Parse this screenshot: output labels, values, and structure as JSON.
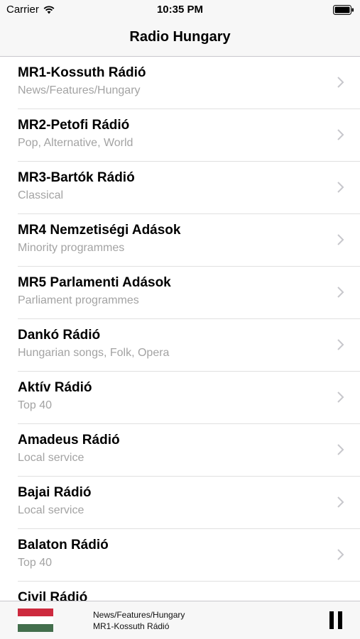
{
  "status_bar": {
    "carrier": "Carrier",
    "time": "10:35 PM",
    "icons": [
      "wifi-icon",
      "battery-icon"
    ]
  },
  "nav": {
    "title": "Radio Hungary"
  },
  "stations": [
    {
      "name": "MR1-Kossuth Rádió",
      "genre": "News/Features/Hungary"
    },
    {
      "name": "MR2-Petofi Rádió",
      "genre": "Pop, Alternative, World"
    },
    {
      "name": "MR3-Bartók Rádió",
      "genre": "Classical"
    },
    {
      "name": "MR4 Nemzetiségi Adások",
      "genre": "Minority programmes"
    },
    {
      "name": "MR5 Parlamenti Adások",
      "genre": "Parliament programmes"
    },
    {
      "name": "Dankó Rádió",
      "genre": "Hungarian songs, Folk, Opera"
    },
    {
      "name": "Aktív Rádió",
      "genre": "Top 40"
    },
    {
      "name": "Amadeus Rádió",
      "genre": "Local service"
    },
    {
      "name": "Bajai Rádió",
      "genre": "Local service"
    },
    {
      "name": "Balaton Rádió",
      "genre": "Top 40"
    },
    {
      "name": "Civil Rádió",
      "genre": ""
    }
  ],
  "player": {
    "genre": "News/Features/Hungary",
    "station": "MR1-Kossuth Rádió",
    "flag_colors": [
      "#cd2a3e",
      "#ffffff",
      "#436f4d"
    ],
    "control_icon": "pause-icon"
  },
  "colors": {
    "bar_background": "#f7f7f7",
    "subtitle": "#a3a3a3",
    "chevron": "#c7c7cc",
    "separator": "#e0e0e0"
  }
}
